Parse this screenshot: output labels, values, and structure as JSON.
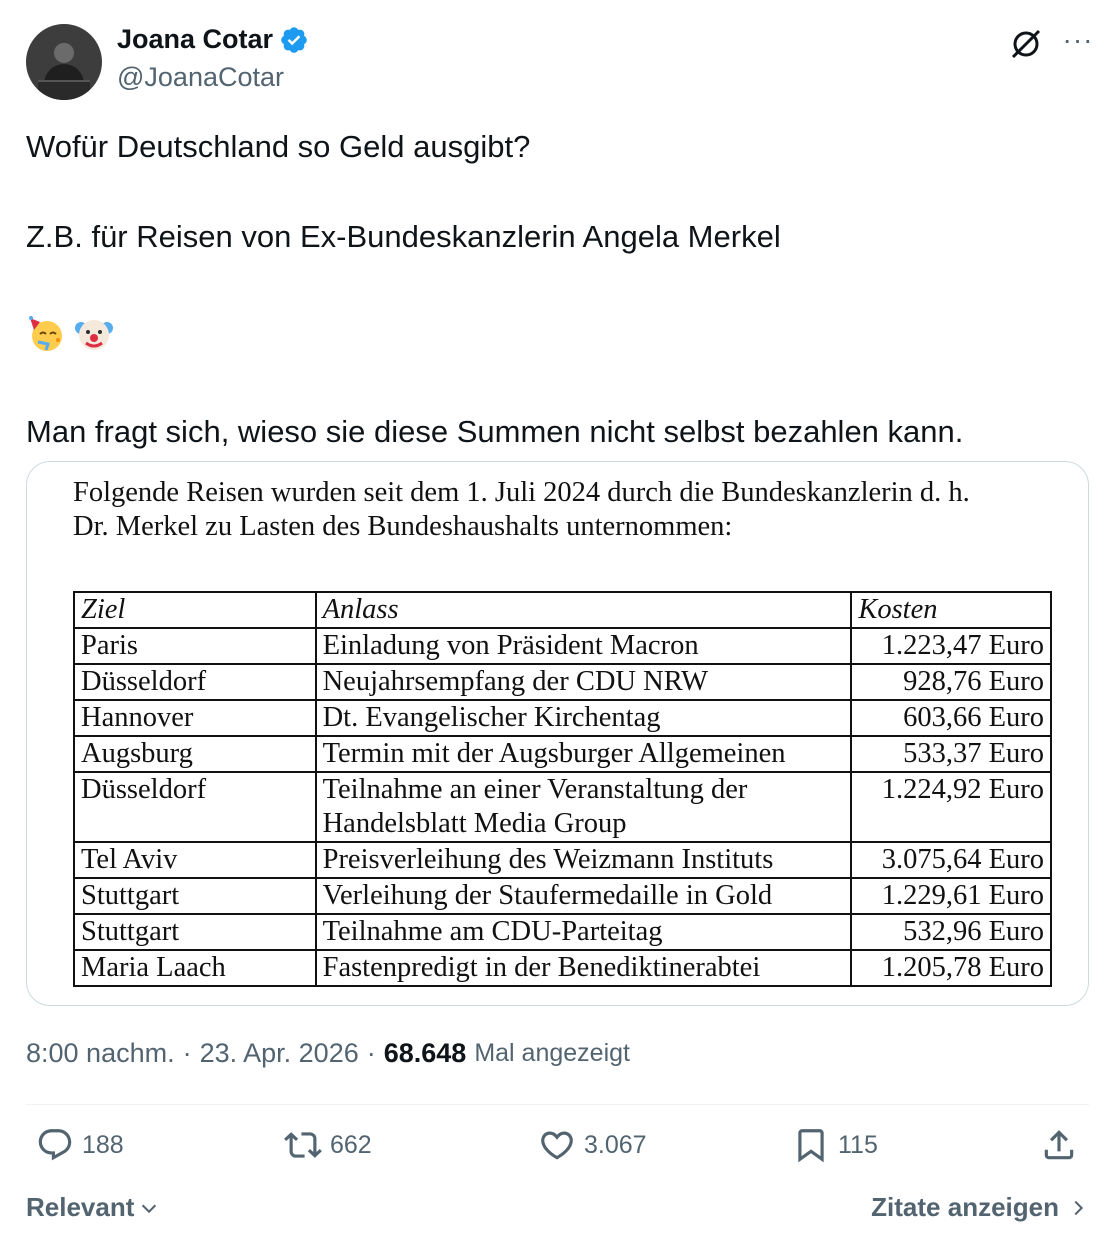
{
  "author": {
    "name": "Joana Cotar",
    "handle": "@JoanaCotar",
    "verified_color": "#1d9bf0"
  },
  "tweet": {
    "line1": "Wofür Deutschland so Geld ausgibt?",
    "line2": "Z.B. für Reisen von Ex-Bundeskanzlerin Angela Merkel",
    "emojis": [
      "party-face-emoji",
      "clown-face-emoji"
    ],
    "line3": "Man fragt sich, wieso sie diese Summen nicht selbst bezahlen kann."
  },
  "document": {
    "intro_line1": "Folgende Reisen wurden seit dem 1. Juli 2024 durch die Bundeskanzlerin d. h.",
    "intro_line2": "Dr. Merkel zu Lasten des Bundeshaushalts unternommen:",
    "headers": [
      "Ziel",
      "Anlass",
      "Kosten"
    ],
    "rows": [
      {
        "ziel": "Paris",
        "anlass": "Einladung von Präsident Macron",
        "kosten": "1.223,47 Euro"
      },
      {
        "ziel": "Düsseldorf",
        "anlass": "Neujahrsempfang der CDU NRW",
        "kosten": "928,76 Euro"
      },
      {
        "ziel": "Hannover",
        "anlass": "Dt. Evangelischer Kirchentag",
        "kosten": "603,66 Euro"
      },
      {
        "ziel": "Augsburg",
        "anlass": "Termin mit der Augsburger Allgemeinen",
        "kosten": "533,37 Euro"
      },
      {
        "ziel": "Düsseldorf",
        "anlass": "Teilnahme an einer Veranstaltung der Handelsblatt Media Group",
        "kosten": "1.224,92 Euro"
      },
      {
        "ziel": "Tel Aviv",
        "anlass": "Preisverleihung des Weizmann Instituts",
        "kosten": "3.075,64 Euro"
      },
      {
        "ziel": "Stuttgart",
        "anlass": "Verleihung der Staufermedaille in Gold",
        "kosten": "1.229,61 Euro"
      },
      {
        "ziel": "Stuttgart",
        "anlass": "Teilnahme am CDU-Parteitag",
        "kosten": "532,96 Euro"
      },
      {
        "ziel": "Maria Laach",
        "anlass": "Fastenpredigt in der Benediktinerabtei",
        "kosten": "1.205,78 Euro"
      }
    ]
  },
  "meta": {
    "time": "8:00 nachm.",
    "sep": "·",
    "date": "23. Apr. 2026",
    "views_count": "68.648",
    "views_label": "Mal angezeigt"
  },
  "actions": {
    "replies": "188",
    "reposts": "662",
    "likes": "3.067",
    "bookmarks": "115"
  },
  "footer": {
    "sort_label": "Relevant",
    "quotes_label": "Zitate anzeigen"
  }
}
